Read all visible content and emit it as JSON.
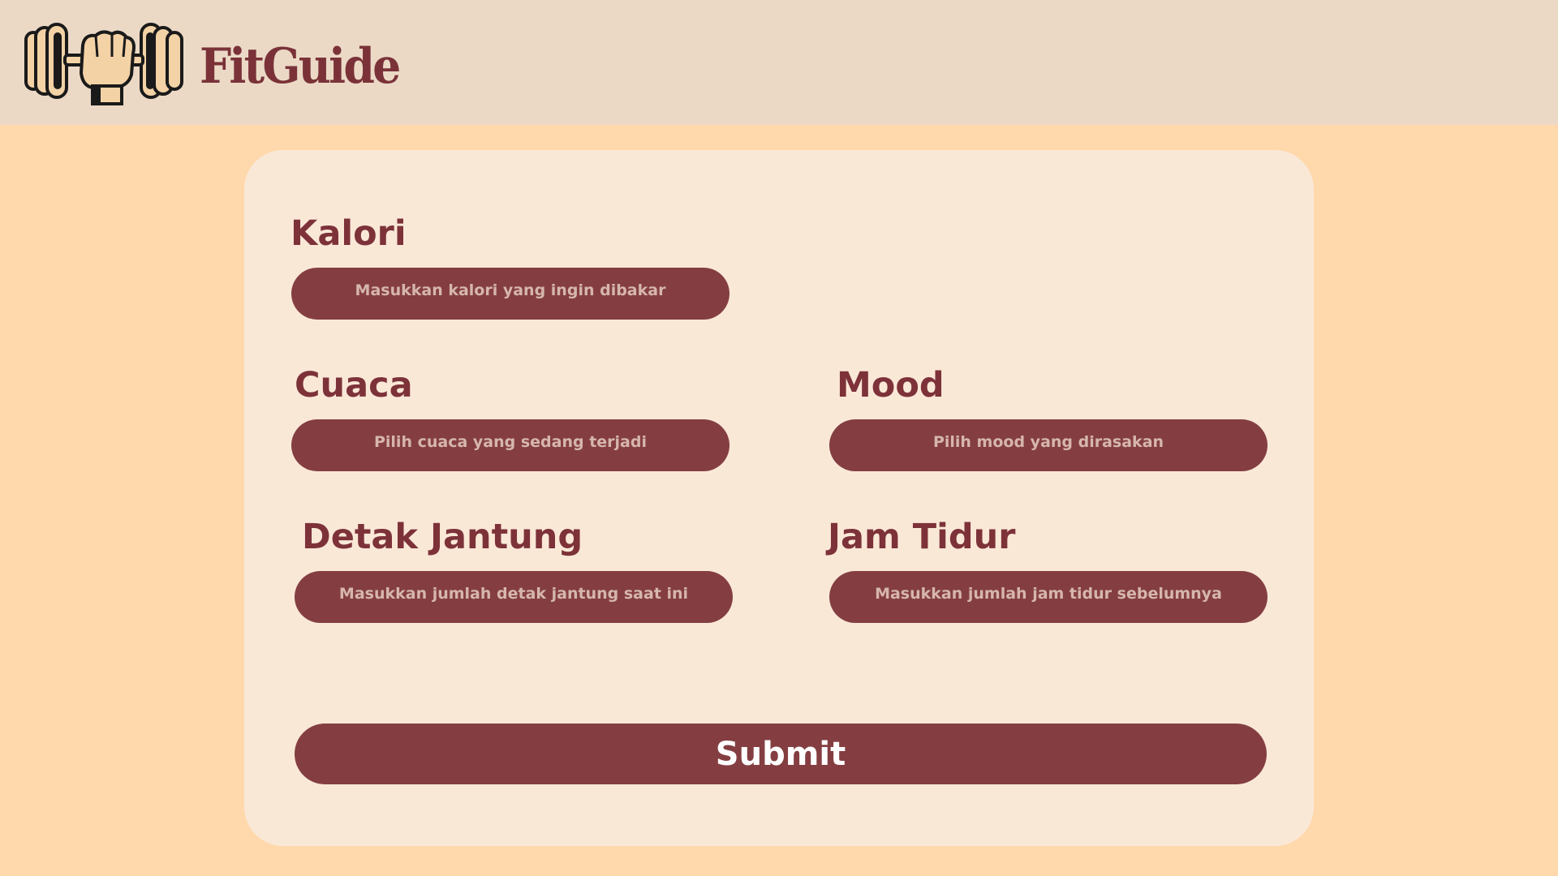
{
  "header": {
    "brand": "FitGuide",
    "logo_icon": "fist-dumbbell-icon"
  },
  "form": {
    "kalori": {
      "label": "Kalori",
      "placeholder": "Masukkan kalori yang ingin dibakar",
      "value": ""
    },
    "cuaca": {
      "label": "Cuaca",
      "placeholder": "Pilih cuaca yang sedang terjadi",
      "value": ""
    },
    "mood": {
      "label": "Mood",
      "placeholder": "Pilih mood yang dirasakan",
      "value": ""
    },
    "detak_jantung": {
      "label": "Detak Jantung",
      "placeholder": "Masukkan jumlah detak jantung saat ini",
      "value": ""
    },
    "jam_tidur": {
      "label": "Jam Tidur",
      "placeholder": "Masukkan jumlah jam tidur sebelumnya",
      "value": ""
    },
    "submit_label": "Submit"
  },
  "colors": {
    "background": "#FFD8AC",
    "header": "#EBD9C6",
    "card": "#FAE8D7",
    "accent": "#843E41",
    "label_text": "#7D3239"
  }
}
